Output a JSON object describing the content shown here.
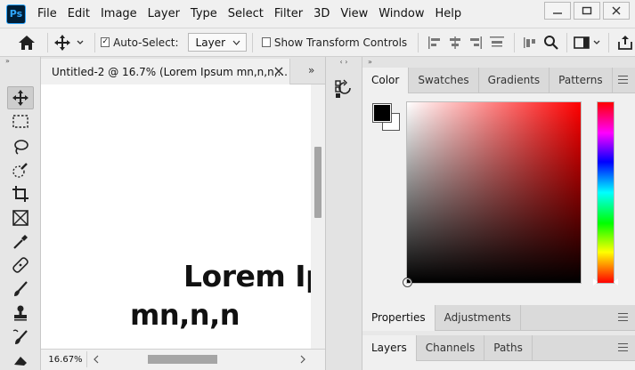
{
  "app": {
    "logo_text": "Ps"
  },
  "menu": [
    "File",
    "Edit",
    "Image",
    "Layer",
    "Type",
    "Select",
    "Filter",
    "3D",
    "View",
    "Window",
    "Help"
  ],
  "options_bar": {
    "auto_select_label": "Auto-Select:",
    "auto_select_checked": true,
    "auto_select_target": "Layer",
    "show_transform_label": "Show Transform Controls",
    "show_transform_checked": false
  },
  "document": {
    "tab_title": "Untitled-2 @ 16.7% (Lorem Ipsum mn,n,n,...",
    "canvas_line1": "Lorem Ipsum",
    "canvas_line2": "mn,n,n",
    "zoom": "16.67%"
  },
  "color_panel": {
    "tabs": [
      "Color",
      "Swatches",
      "Gradients",
      "Patterns"
    ],
    "active_tab": "Color",
    "foreground": "#000000",
    "background": "#ffffff",
    "hue": "#ff0000"
  },
  "properties_panel": {
    "tabs": [
      "Properties",
      "Adjustments"
    ],
    "active_tab": "Properties"
  },
  "layers_panel": {
    "tabs": [
      "Layers",
      "Channels",
      "Paths"
    ],
    "active_tab": "Layers"
  },
  "collapse_glyph": "»",
  "panel_grip": "‹ ›"
}
